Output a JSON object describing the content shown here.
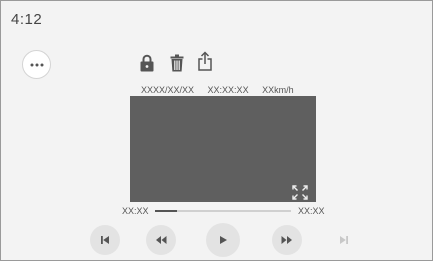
{
  "status": {
    "time": "4:12"
  },
  "toolbar": {
    "more_icon": "more-dots-icon",
    "lock_icon": "lock-icon",
    "delete_icon": "trash-icon",
    "share_icon": "share-icon"
  },
  "video": {
    "date": "XXXX/XX/XX",
    "time": "XX:XX:XX",
    "speed": "XXkm/h",
    "expand_icon": "expand-icon"
  },
  "playback": {
    "current_time": "XX:XX",
    "total_time": "XX:XX",
    "progress": 0.16
  },
  "controls": [
    {
      "name": "previous-track-button",
      "icon": "skip-previous-icon"
    },
    {
      "name": "rewind-button",
      "icon": "rewind-icon"
    },
    {
      "name": "play-button",
      "icon": "play-icon"
    },
    {
      "name": "fast-forward-button",
      "icon": "fast-forward-icon"
    },
    {
      "name": "next-track-button",
      "icon": "skip-next-icon",
      "disabled": true
    }
  ],
  "colors": {
    "background": "#f3f3f3",
    "video": "#5f5f5f",
    "icon": "#555555",
    "disabled_icon": "#c8c8c8",
    "button": "#e3e3e3"
  }
}
